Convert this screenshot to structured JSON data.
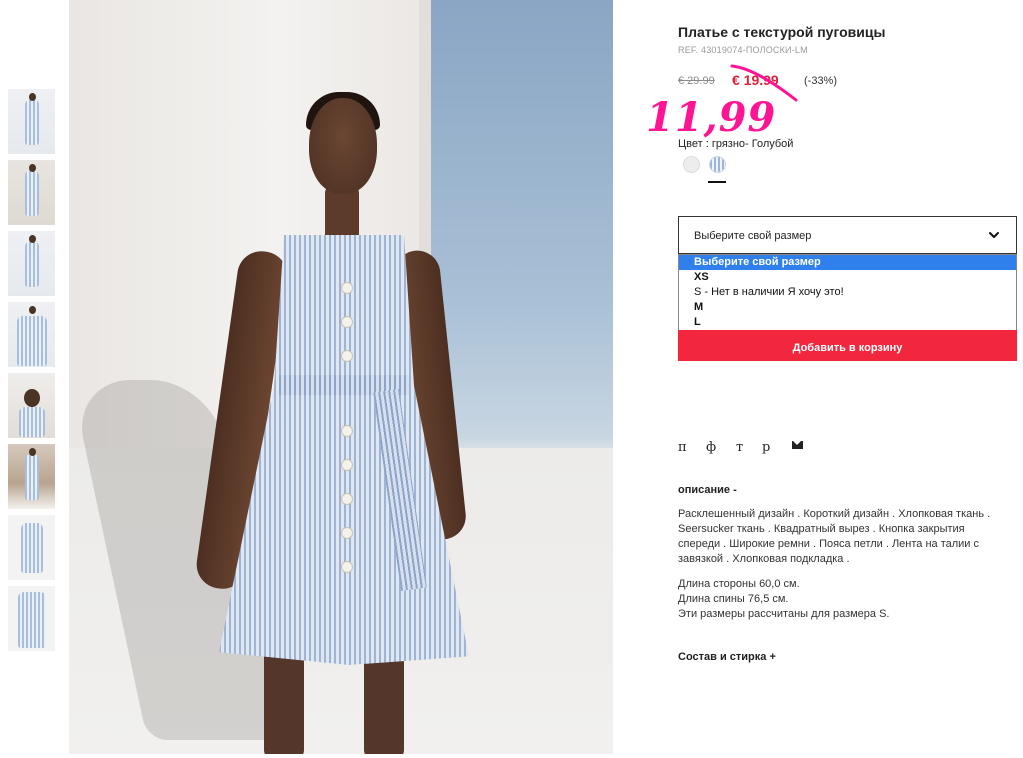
{
  "product": {
    "title": "Платье с текстурой пуговицы",
    "ref": "REF. 43019074-ПОЛОСКИ-LM",
    "price_old": "€ 29.99",
    "price_new": "€ 19.99",
    "discount": "(-33%)",
    "handwritten_price": "11,99",
    "color_label": "Цвет : грязно- Голубой"
  },
  "colors": {
    "accent_red": "#f2273e",
    "price_red": "#e0203a",
    "handwritten_pink": "#ff1493",
    "select_highlight": "#2f80ed"
  },
  "size_select": {
    "value": "Выберите свой размер",
    "options": [
      "Выберите свой размер",
      "XS",
      "S - Нет в наличии Я хочу это!",
      "M",
      "L"
    ]
  },
  "cart_button": "Добавить в корзину",
  "share": {
    "items": [
      "п",
      "ф",
      "т",
      "р"
    ],
    "mail_icon": "mail-icon"
  },
  "description": {
    "heading": "описание -",
    "text": "Расклешенный дизайн . Короткий дизайн . Хлопковая ткань . Seersucker ткань . Квадратный вырез . Кнопка закрытия спереди . Широкие ремни . Пояса петли . Лента на талии с завязкой . Хлопковая подкладка .",
    "measure_1": "Длина стороны 60,0 см.",
    "measure_2": "Длина спины 76,5 см.",
    "measure_3": "Эти размеры рассчитаны для размера S."
  },
  "care_heading": "Состав и стирка +"
}
